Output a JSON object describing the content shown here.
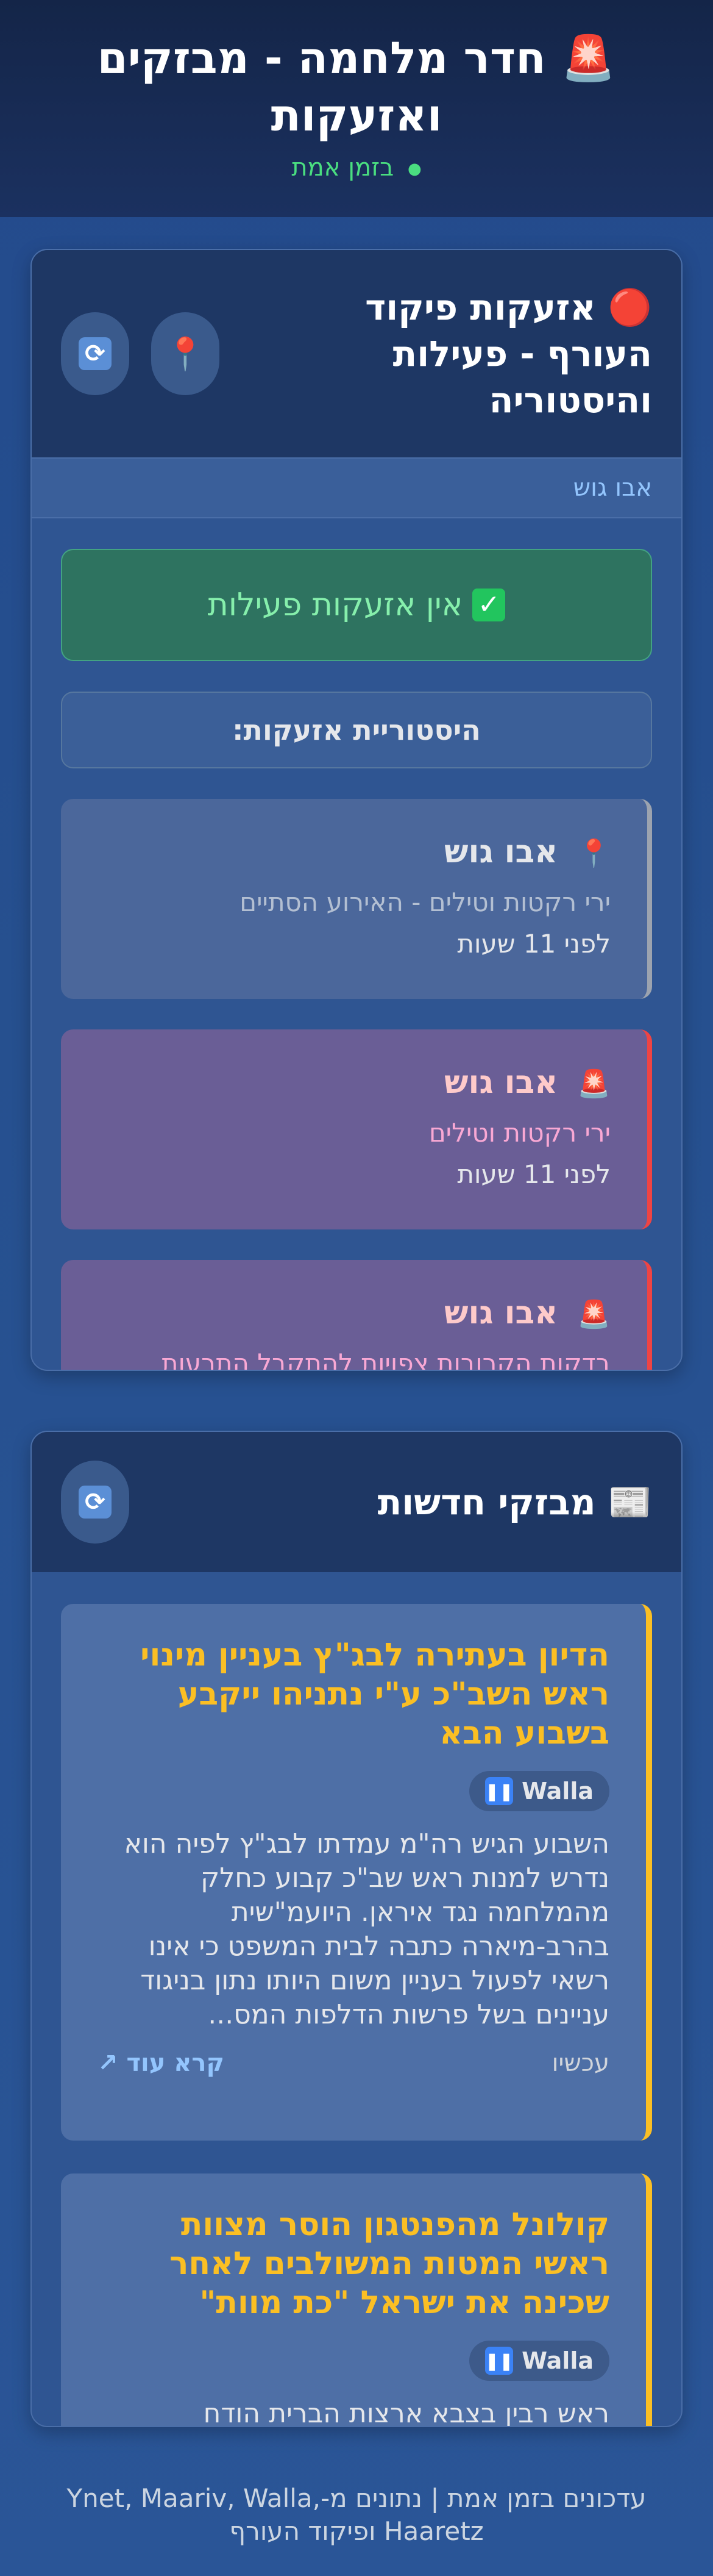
{
  "header": {
    "title": "חדר מלחמה - מבזקים ואזעקות",
    "title_icon": "🚨",
    "status": "בזמן אמת",
    "status_color": "#4ade80"
  },
  "alerts": {
    "title": "אזעקות פיקוד העורף - פעילות והיסטוריה",
    "title_icon": "🔴",
    "location": "אבו גוש",
    "no_alerts": "אין אזעקות פעילות",
    "history_label": "היסטוריית אזעקות:",
    "items": [
      {
        "icon": "📍",
        "place": "אבו גוש",
        "type": "ירי רקטות וטילים - האירוע הסתיים",
        "time": "לפני 11 שעות",
        "status": "past"
      },
      {
        "icon": "🚨",
        "place": "אבו גוש",
        "type": "ירי רקטות וטילים",
        "time": "לפני 11 שעות",
        "status": "active"
      },
      {
        "icon": "🚨",
        "place": "אבו גוש",
        "type": "בדקות הקרובות צפויות להתקבל התרעות",
        "time": "",
        "status": "active"
      }
    ]
  },
  "news": {
    "title": "מבזקי חדשות",
    "title_icon": "📰",
    "read_more": "קרא עוד ↗",
    "items": [
      {
        "title": "הדיון בעתירה לבג\"ץ בעניין מינוי ראש השב\"כ ע\"י נתניהו ייקבע בשבוע הבא",
        "source": "Walla",
        "body": "השבוע הגיש רה\"מ עמדתו לבג\"ץ לפיה הוא נדרש למנות ראש שב\"כ קבוע כחלק מהמלחמה נגד איראן. היועמ\"שית בהרב-מיארה כתבה לבית המשפט כי אינו רשאי לפעול בעניין משום היותו נתון בניגוד עניינים בשל פרשות הדלפות המס...",
        "time": "עכשיו"
      },
      {
        "title": "קולונל מהפנטגון הוסר מצוות ראשי המטות המשולבים לאחר שכינה את ישראל \"כת מוות\"",
        "source": "Walla",
        "body": "ראש רבין בצבא ארצות הברית הודח",
        "time": ""
      }
    ]
  },
  "footer": {
    "text": "עדכונים בזמן אמת | נתונים מ-Ynet, Maariv, Walla, Haaretz ופיקוד העורף"
  }
}
